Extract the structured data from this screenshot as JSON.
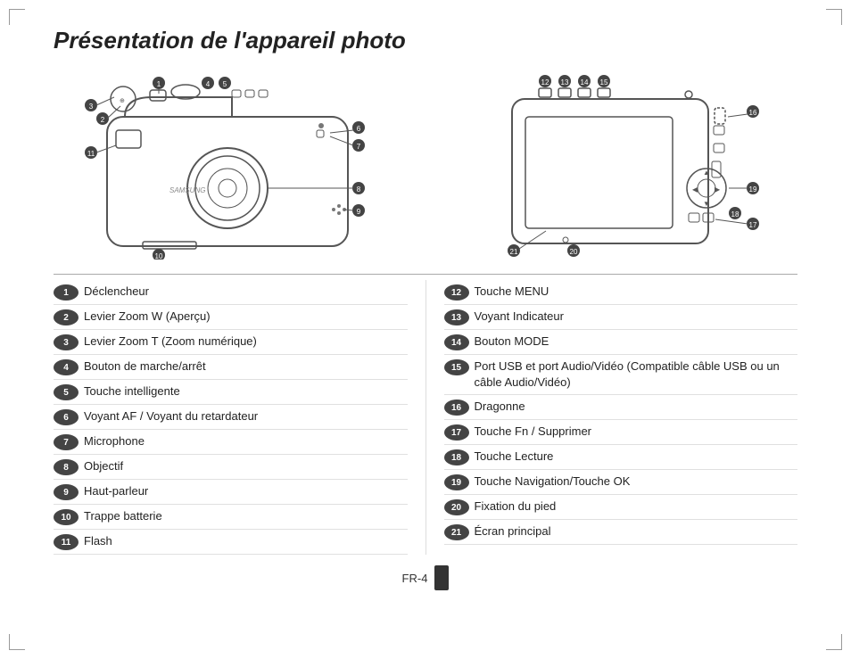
{
  "title": "Présentation de l'appareil photo",
  "footer": "FR-4",
  "parts_left": [
    {
      "num": "1",
      "label": "Déclencheur"
    },
    {
      "num": "2",
      "label": "Levier Zoom W (Aperçu)"
    },
    {
      "num": "3",
      "label": "Levier Zoom T (Zoom numérique)"
    },
    {
      "num": "4",
      "label": "Bouton de marche/arrêt"
    },
    {
      "num": "5",
      "label": "Touche intelligente"
    },
    {
      "num": "6",
      "label": "Voyant AF / Voyant du retardateur"
    },
    {
      "num": "7",
      "label": "Microphone"
    },
    {
      "num": "8",
      "label": "Objectif"
    },
    {
      "num": "9",
      "label": "Haut-parleur"
    },
    {
      "num": "10",
      "label": "Trappe batterie"
    },
    {
      "num": "11",
      "label": "Flash"
    }
  ],
  "parts_right": [
    {
      "num": "12",
      "label": "Touche MENU"
    },
    {
      "num": "13",
      "label": "Voyant Indicateur"
    },
    {
      "num": "14",
      "label": "Bouton MODE"
    },
    {
      "num": "15",
      "label": "Port USB et port Audio/Vidéo (Compatible câble USB ou un câble Audio/Vidéo)"
    },
    {
      "num": "16",
      "label": "Dragonne"
    },
    {
      "num": "17",
      "label": "Touche Fn / Supprimer"
    },
    {
      "num": "18",
      "label": "Touche Lecture"
    },
    {
      "num": "19",
      "label": "Touche Navigation/Touche OK"
    },
    {
      "num": "20",
      "label": "Fixation du pied"
    },
    {
      "num": "21",
      "label": "Écran principal"
    }
  ]
}
